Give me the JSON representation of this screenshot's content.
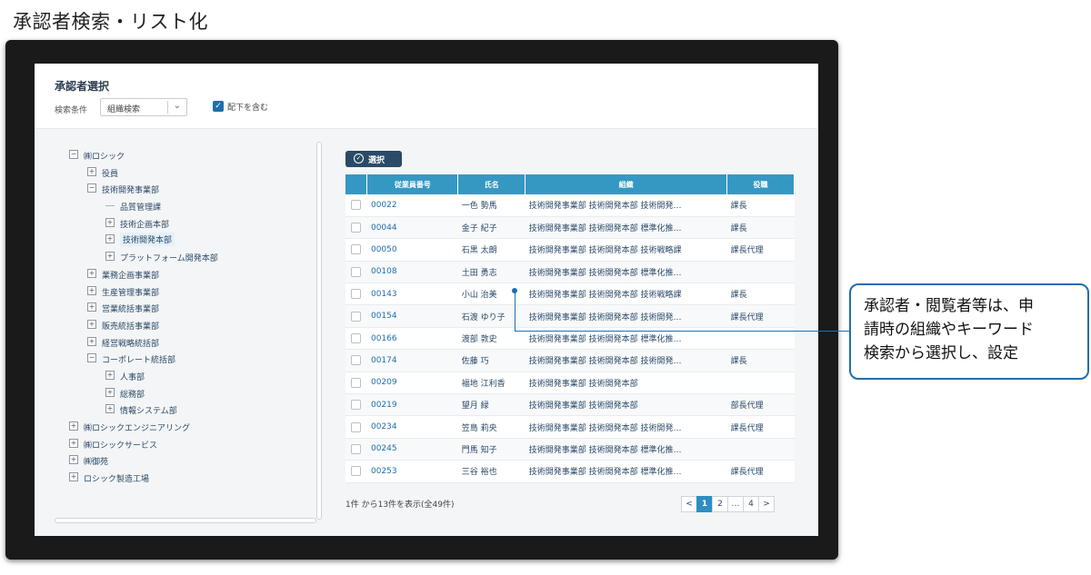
{
  "slide_title": "承認者検索・リスト化",
  "panel": {
    "title": "承認者選択",
    "condition_label": "検索条件",
    "condition_value": "組織検索",
    "include_sub_label": "配下を含む",
    "include_sub_checked": true
  },
  "tree": [
    {
      "label": "㈱ロシック",
      "level": 0,
      "state": "minus"
    },
    {
      "label": "役員",
      "level": 1,
      "state": "plus"
    },
    {
      "label": "技術開発事業部",
      "level": 1,
      "state": "minus"
    },
    {
      "label": "品質管理課",
      "level": 2,
      "state": "leaf"
    },
    {
      "label": "技術企画本部",
      "level": 2,
      "state": "plus"
    },
    {
      "label": "技術開発本部",
      "level": 2,
      "state": "plus",
      "selected": true
    },
    {
      "label": "プラットフォーム開発本部",
      "level": 2,
      "state": "plus"
    },
    {
      "label": "業務企画事業部",
      "level": 1,
      "state": "plus"
    },
    {
      "label": "生産管理事業部",
      "level": 1,
      "state": "plus"
    },
    {
      "label": "営業統括事業部",
      "level": 1,
      "state": "plus"
    },
    {
      "label": "販売統括事業部",
      "level": 1,
      "state": "plus"
    },
    {
      "label": "経営戦略統括部",
      "level": 1,
      "state": "plus"
    },
    {
      "label": "コーポレート統括部",
      "level": 1,
      "state": "minus"
    },
    {
      "label": "人事部",
      "level": 2,
      "state": "plus"
    },
    {
      "label": "総務部",
      "level": 2,
      "state": "plus"
    },
    {
      "label": "情報システム部",
      "level": 2,
      "state": "plus"
    },
    {
      "label": "㈱ロシックエンジニアリング",
      "level": 0,
      "state": "plus"
    },
    {
      "label": "㈱ロシックサービス",
      "level": 0,
      "state": "plus"
    },
    {
      "label": "㈱御苑",
      "level": 0,
      "state": "plus"
    },
    {
      "label": "ロシック製造工場",
      "level": 0,
      "state": "plus"
    }
  ],
  "select_button": "選択",
  "table": {
    "headers": [
      "従業員番号",
      "氏名",
      "組織",
      "役職"
    ],
    "rows": [
      [
        "00022",
        "一色 勢馬",
        "技術開発事業部 技術開発本部 技術開発…",
        "課長"
      ],
      [
        "00044",
        "金子 紀子",
        "技術開発事業部 技術開発本部 標準化推…",
        "課長"
      ],
      [
        "00050",
        "石黒 太朗",
        "技術開発事業部 技術開発本部 技術戦略課",
        "課長代理"
      ],
      [
        "00108",
        "土田 勇志",
        "技術開発事業部 技術開発本部 標準化推…",
        ""
      ],
      [
        "00143",
        "小山 治美",
        "技術開発事業部 技術開発本部 技術戦略課",
        "課長"
      ],
      [
        "00154",
        "石渡 ゆり子",
        "技術開発事業部 技術開発本部 技術開発…",
        "課長代理"
      ],
      [
        "00166",
        "渡部 敦史",
        "技術開発事業部 技術開発本部 標準化推…",
        ""
      ],
      [
        "00174",
        "佐藤 巧",
        "技術開発事業部 技術開発本部 技術開発…",
        "課長"
      ],
      [
        "00209",
        "福地 江利香",
        "技術開発事業部 技術開発本部",
        ""
      ],
      [
        "00219",
        "望月 緑",
        "技術開発事業部 技術開発本部",
        "部長代理"
      ],
      [
        "00234",
        "笠島 莉央",
        "技術開発事業部 技術開発本部 技術開発…",
        "課長代理"
      ],
      [
        "00245",
        "門馬 知子",
        "技術開発事業部 技術開発本部 標準化推…",
        ""
      ],
      [
        "00253",
        "三谷 裕也",
        "技術開発事業部 技術開発本部 標準化推…",
        "課長代理"
      ]
    ]
  },
  "pagination": {
    "info": "1件 から13件を表示(全49件)",
    "prev": "<",
    "pages": [
      "1",
      "2",
      "…",
      "4"
    ],
    "next": ">",
    "current": "1"
  },
  "callout": {
    "lines": [
      "承認者・閲覧者等は、申",
      "請時の組織やキーワード",
      "検索から選択し、設定"
    ]
  }
}
